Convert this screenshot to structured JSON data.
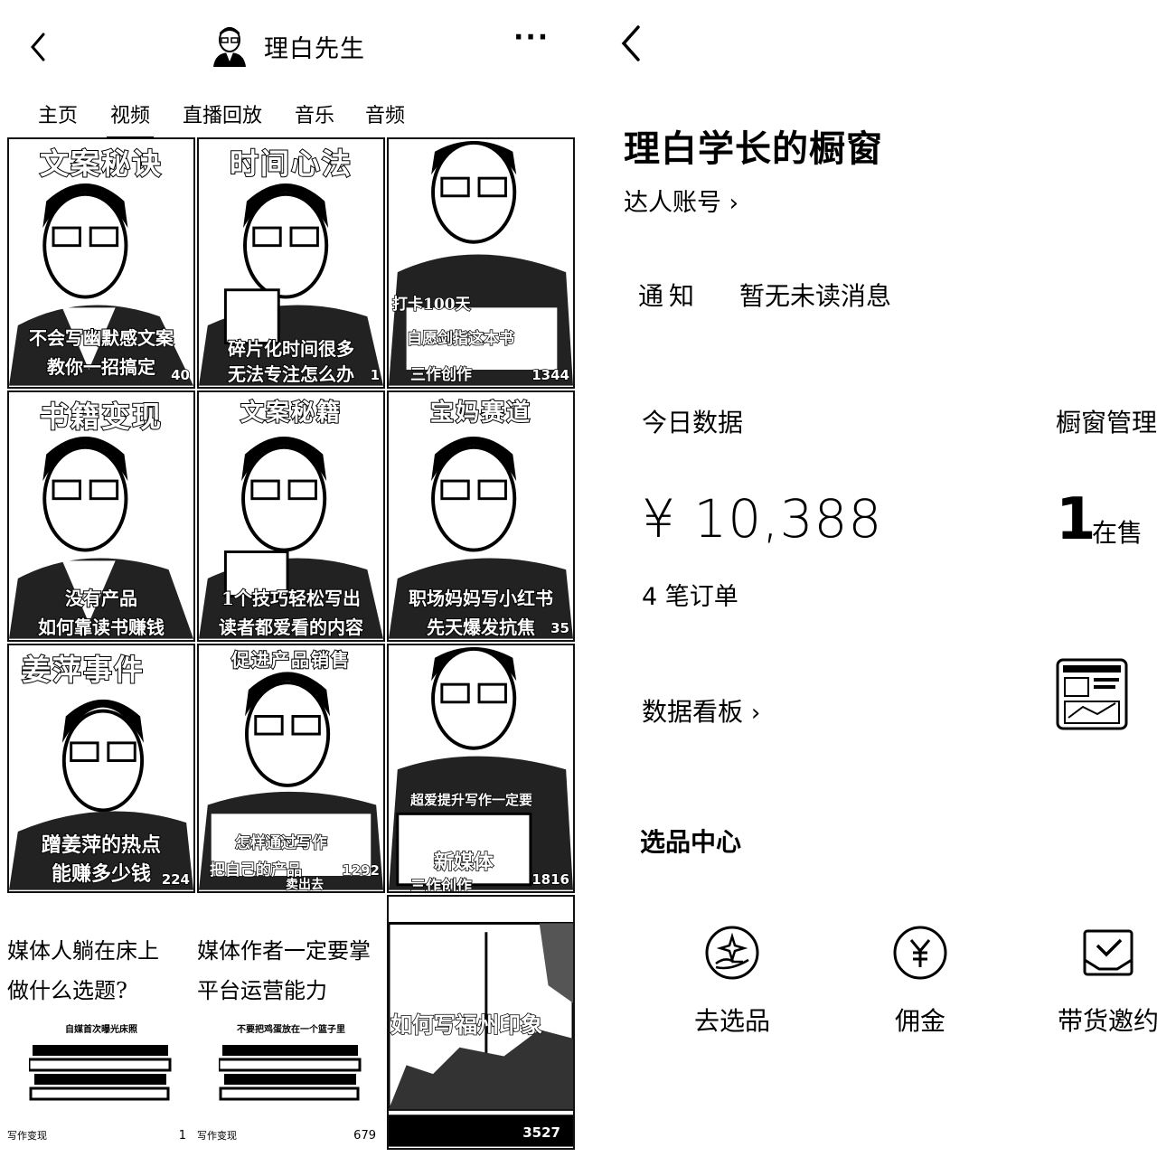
{
  "left": {
    "header": {
      "name": "理白先生",
      "more": "···"
    },
    "tabs": [
      "主页",
      "视频",
      "直播回放",
      "音乐",
      "音频"
    ],
    "tiles": [
      {
        "title": "文案秘诀",
        "cap1": "不会写幽默感文案",
        "cap2": "教你一招搞定",
        "views": "40"
      },
      {
        "title": "时间心法",
        "cap1": "碎片化时间很多",
        "cap2": "无法专注怎么办",
        "views": "1"
      },
      {
        "title": "",
        "cap1": "打卡100天",
        "cap2": "自愿剑指这本书",
        "cap3": "三作创作",
        "views": "1344"
      },
      {
        "title": "书籍变现",
        "cap1": "没有产品",
        "cap2": "如何靠读书赚钱",
        "views": ""
      },
      {
        "title": "文案秘籍",
        "cap1": "1个技巧轻松写出",
        "cap2": "读者都爱看的内容",
        "views": ""
      },
      {
        "title": "宝妈赛道",
        "cap1": "职场妈妈写小红书",
        "cap2": "先天爆发抗焦",
        "views": "35"
      },
      {
        "title": "姜萍事件",
        "cap1": "蹭姜萍的热点",
        "cap2": "能赚多少钱",
        "views": "224"
      },
      {
        "title": "促进产品销售",
        "cap1": "怎样通过写作",
        "cap2": "把自己的产品",
        "cap3": "卖出去",
        "views": "1292"
      },
      {
        "title": "",
        "cap1": "超爱提升写作一定要",
        "cap2": "新媒体",
        "cap3": "三作创作",
        "views": "1816"
      }
    ],
    "text_tiles": [
      {
        "line1": "媒体人躺在床上",
        "line2": "做什么选题?",
        "book": "自媒首次曝光床照",
        "footer": "写作变现",
        "views": "1"
      },
      {
        "line1": "媒体作者一定要掌",
        "line2": "平台运营能力",
        "book": "不要把鸡蛋放在一个篮子里",
        "footer": "写作变现",
        "views": "679"
      }
    ],
    "last_tile": {
      "caption": "如何写福州印象",
      "views": "3527"
    }
  },
  "right": {
    "shop_title": "理白学长的橱窗",
    "account_link": "达人账号",
    "notice_label": "通知",
    "notice_text": "暂无未读消息",
    "today_label": "今日数据",
    "window_manage": "橱窗管理",
    "revenue": "¥ 10,388",
    "orders": "4 笔订单",
    "on_sale_count": "1",
    "on_sale_label": "在售",
    "dashboard_link": "数据看板",
    "selection_title": "选品中心",
    "shortcuts": [
      "去选品",
      "佣金",
      "带货邀约"
    ]
  }
}
